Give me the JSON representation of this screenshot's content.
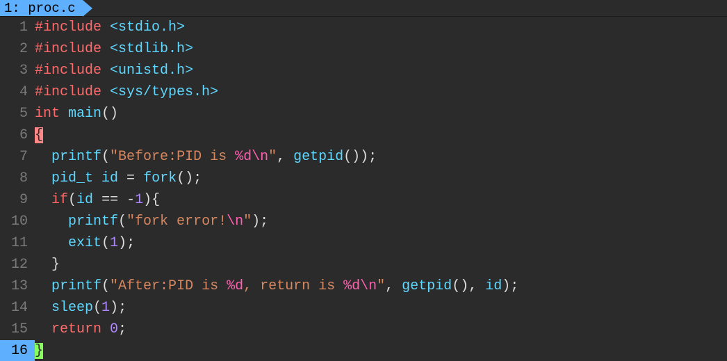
{
  "tab": {
    "index": "1:",
    "filename": "proc.c"
  },
  "current_line": 16,
  "lines": [
    {
      "n": 1,
      "tokens": [
        [
          "kw-pre",
          "#include "
        ],
        [
          "header",
          "<stdio.h>"
        ]
      ]
    },
    {
      "n": 2,
      "tokens": [
        [
          "kw-pre",
          "#include "
        ],
        [
          "header",
          "<stdlib.h>"
        ]
      ]
    },
    {
      "n": 3,
      "tokens": [
        [
          "kw-pre",
          "#include "
        ],
        [
          "header",
          "<unistd.h>"
        ]
      ]
    },
    {
      "n": 4,
      "tokens": [
        [
          "kw-pre",
          "#include "
        ],
        [
          "header",
          "<sys/types.h>"
        ]
      ]
    },
    {
      "n": 5,
      "tokens": [
        [
          "kw-type",
          "int "
        ],
        [
          "ident",
          "main"
        ],
        [
          "paren",
          "()"
        ]
      ]
    },
    {
      "n": 6,
      "tokens": [
        [
          "brace-hl",
          "{"
        ]
      ]
    },
    {
      "n": 7,
      "tokens": [
        [
          "plain",
          "  "
        ],
        [
          "ident",
          "printf"
        ],
        [
          "paren",
          "("
        ],
        [
          "str",
          "\"Before:PID is "
        ],
        [
          "esc",
          "%d\\n"
        ],
        [
          "str",
          "\""
        ],
        [
          "punc",
          ", "
        ],
        [
          "ident",
          "getpid"
        ],
        [
          "paren",
          "())"
        ],
        [
          "punc",
          ";"
        ]
      ]
    },
    {
      "n": 8,
      "tokens": [
        [
          "plain",
          "  "
        ],
        [
          "ident",
          "pid_t id"
        ],
        [
          "plain",
          " "
        ],
        [
          "op",
          "="
        ],
        [
          "plain",
          " "
        ],
        [
          "ident",
          "fork"
        ],
        [
          "paren",
          "()"
        ],
        [
          "punc",
          ";"
        ]
      ]
    },
    {
      "n": 9,
      "tokens": [
        [
          "plain",
          "  "
        ],
        [
          "kw-type",
          "if"
        ],
        [
          "paren",
          "("
        ],
        [
          "ident",
          "id"
        ],
        [
          "plain",
          " "
        ],
        [
          "op",
          "=="
        ],
        [
          "plain",
          " "
        ],
        [
          "op",
          "-"
        ],
        [
          "num",
          "1"
        ],
        [
          "paren",
          ")"
        ],
        [
          "plain",
          "{"
        ]
      ]
    },
    {
      "n": 10,
      "tokens": [
        [
          "plain",
          "    "
        ],
        [
          "ident",
          "printf"
        ],
        [
          "paren",
          "("
        ],
        [
          "str",
          "\"fork error!"
        ],
        [
          "esc",
          "\\n"
        ],
        [
          "str",
          "\""
        ],
        [
          "paren",
          ")"
        ],
        [
          "punc",
          ";"
        ]
      ]
    },
    {
      "n": 11,
      "tokens": [
        [
          "plain",
          "    "
        ],
        [
          "ident",
          "exit"
        ],
        [
          "paren",
          "("
        ],
        [
          "num",
          "1"
        ],
        [
          "paren",
          ")"
        ],
        [
          "punc",
          ";"
        ]
      ]
    },
    {
      "n": 12,
      "tokens": [
        [
          "plain",
          "  }"
        ]
      ]
    },
    {
      "n": 13,
      "tokens": [
        [
          "plain",
          "  "
        ],
        [
          "ident",
          "printf"
        ],
        [
          "paren",
          "("
        ],
        [
          "str",
          "\"After:PID is "
        ],
        [
          "esc",
          "%d"
        ],
        [
          "str",
          ", return is "
        ],
        [
          "esc",
          "%d\\n"
        ],
        [
          "str",
          "\""
        ],
        [
          "punc",
          ", "
        ],
        [
          "ident",
          "getpid"
        ],
        [
          "paren",
          "()"
        ],
        [
          "punc",
          ", "
        ],
        [
          "ident",
          "id"
        ],
        [
          "paren",
          ")"
        ],
        [
          "punc",
          ";"
        ]
      ]
    },
    {
      "n": 14,
      "tokens": [
        [
          "plain",
          "  "
        ],
        [
          "ident",
          "sleep"
        ],
        [
          "paren",
          "("
        ],
        [
          "num",
          "1"
        ],
        [
          "paren",
          ")"
        ],
        [
          "punc",
          ";"
        ]
      ]
    },
    {
      "n": 15,
      "tokens": [
        [
          "plain",
          "  "
        ],
        [
          "kw-type",
          "return "
        ],
        [
          "num",
          "0"
        ],
        [
          "punc",
          ";"
        ]
      ]
    },
    {
      "n": 16,
      "tokens": [
        [
          "brace-cur",
          "}"
        ]
      ]
    }
  ]
}
